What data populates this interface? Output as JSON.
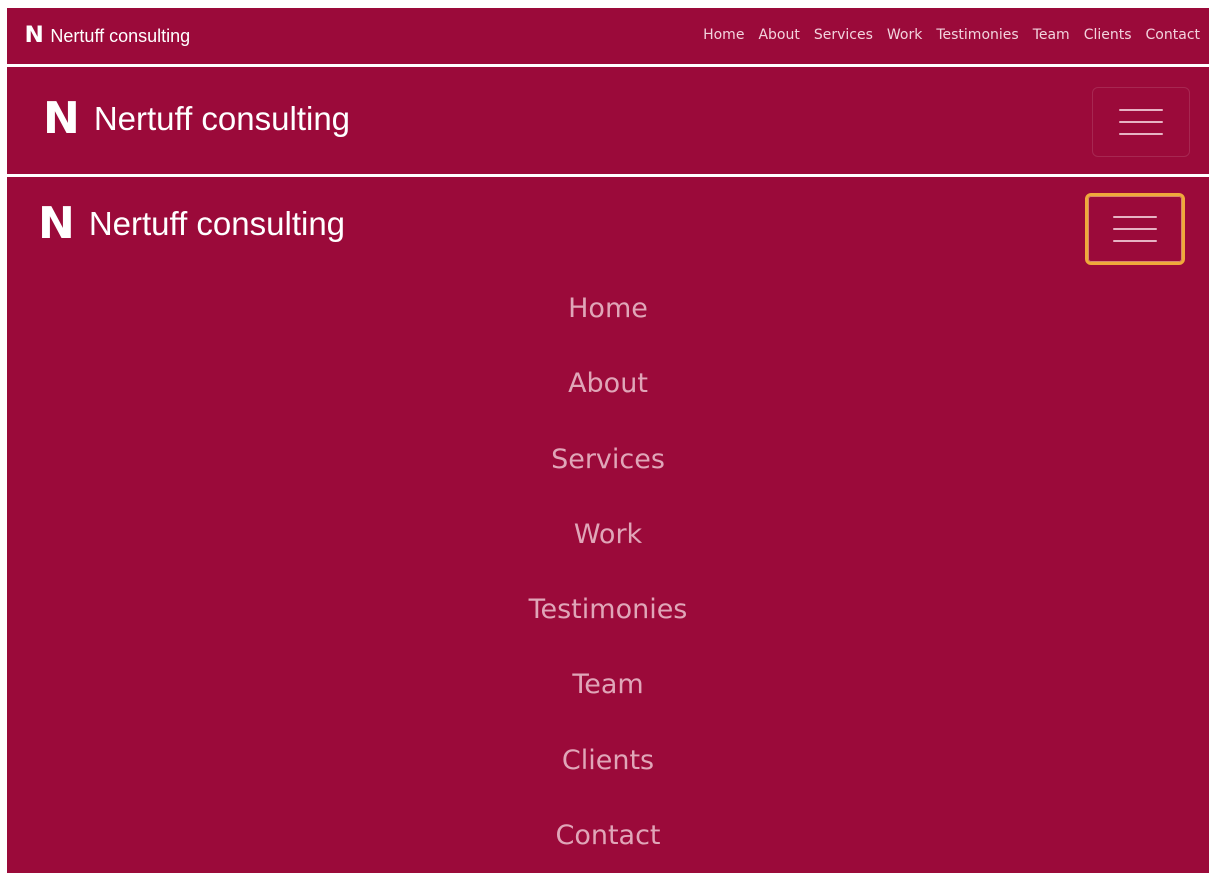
{
  "brand": {
    "logo_letter": "N",
    "name": "Nertuff consulting"
  },
  "nav": {
    "items": [
      {
        "label": "Home"
      },
      {
        "label": "About"
      },
      {
        "label": "Services"
      },
      {
        "label": "Work"
      },
      {
        "label": "Testimonies"
      },
      {
        "label": "Team"
      },
      {
        "label": "Clients"
      },
      {
        "label": "Contact"
      }
    ]
  },
  "toggler": {
    "icon": "hamburger-menu-icon",
    "focused_ring_color": "#f0a93a"
  },
  "colors": {
    "navbar_bg": "#9b0a3a",
    "link_desktop": "#f2d3dd",
    "link_mobile": "#e0a6b8",
    "brand_text": "#ffffff"
  }
}
